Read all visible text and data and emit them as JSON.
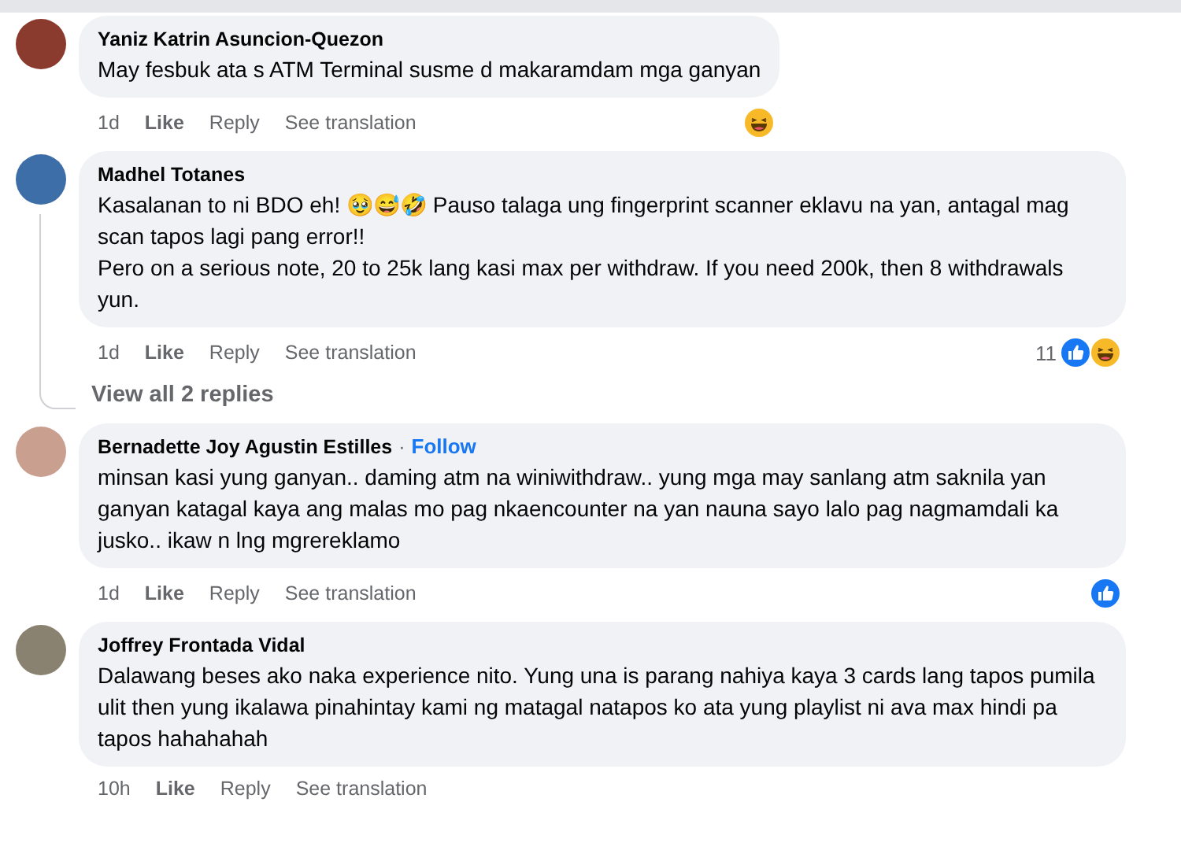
{
  "comments": [
    {
      "author": "Yaniz Katrin Asuncion-Quezon",
      "text": "May fesbuk ata s ATM Terminal susme d makaramdam mga ganyan",
      "time": "1d",
      "actions": [
        "Like",
        "Reply",
        "See translation"
      ],
      "reactions": [
        {
          "kind": "haha"
        }
      ]
    },
    {
      "author": "Madhel Totanes",
      "text": "Kasalanan to ni BDO eh! 🥹😅🤣 Pauso talaga ung fingerprint scanner eklavu na yan, antagal mag scan tapos lagi pang error!!\nPero on a serious note, 20 to 25k lang kasi max per withdraw. If you need 200k, then 8 withdrawals yun.",
      "time": "1d",
      "actions": [
        "Like",
        "Reply",
        "See translation"
      ],
      "reaction_count": "11",
      "reactions": [
        {
          "kind": "like"
        },
        {
          "kind": "haha"
        }
      ],
      "replies_link": "View all 2 replies"
    },
    {
      "author": "Bernadette Joy Agustin Estilles",
      "separator": "·",
      "follow": "Follow",
      "text": "minsan kasi yung ganyan.. daming atm na winiwithdraw.. yung mga may sanlang atm saknila yan ganyan katagal kaya ang malas mo pag nkaencounter na yan nauna sayo lalo pag nagmamdali ka jusko.. ikaw n lng mgrereklamo",
      "time": "1d",
      "actions": [
        "Like",
        "Reply",
        "See translation"
      ],
      "reactions": [
        {
          "kind": "like"
        }
      ]
    },
    {
      "author": "Joffrey Frontada Vidal",
      "text": "Dalawang beses ako naka experience nito. Yung una is parang nahiya kaya 3 cards lang tapos pumila ulit then yung ikalawa pinahintay kami ng matagal natapos ko ata yung playlist ni ava max hindi pa tapos hahahahah",
      "time": "10h",
      "actions": [
        "Like",
        "Reply",
        "See translation"
      ]
    }
  ]
}
